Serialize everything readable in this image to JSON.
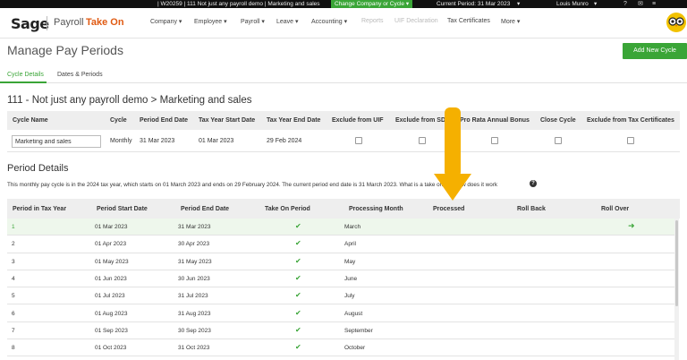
{
  "topbar": {
    "company": "| W20259 | 111 Not just any payroll demo | Marketing and sales",
    "change_button": "Change Company or Cycle ▾",
    "period": "Current Period: 31 Mar 2023",
    "user": "Louis Munro"
  },
  "header": {
    "logo": "Sage",
    "product": "Payroll",
    "module": "Take On",
    "nav": [
      {
        "label": "Company ▾"
      },
      {
        "label": "Employee ▾"
      },
      {
        "label": "Payroll ▾"
      },
      {
        "label": "Leave ▾"
      },
      {
        "label": "Accounting ▾"
      },
      {
        "label": "Reports"
      },
      {
        "label": "UIF Declaration"
      },
      {
        "label": "Tax Certificates"
      },
      {
        "label": "More ▾"
      }
    ]
  },
  "page": {
    "title": "Manage Pay Periods",
    "add_button": "Add New Cycle",
    "tabs": [
      {
        "label": "Cycle Details"
      },
      {
        "label": "Dates & Periods"
      }
    ],
    "section_title": "111 - Not just any payroll demo > Marketing and sales"
  },
  "cycle_table": {
    "headers": [
      "Cycle Name",
      "Cycle",
      "Period End Date",
      "Tax Year Start Date",
      "Tax Year End Date",
      "Exclude from UIF",
      "Exclude from SDL",
      "Pro Rata Annual Bonus",
      "Close Cycle",
      "Exclude from Tax Certificates"
    ],
    "row": {
      "name": "Marketing and sales",
      "cycle": "Monthly",
      "period_end": "31 Mar 2023",
      "tax_start": "01 Mar 2023",
      "tax_end": "29 Feb 2024"
    }
  },
  "period_details": {
    "title": "Period Details",
    "description": "This monthly pay cycle is in the 2024 tax year, which starts on 01 March 2023 and ends on 29 February 2024. The current period end date is 31 March 2023. What is a take on and how does it work",
    "headers": [
      "Period in Tax Year",
      "Period Start Date",
      "Period End Date",
      "Take On Period",
      "Processing Month",
      "Processed",
      "Roll Back",
      "Roll Over"
    ],
    "rows": [
      {
        "num": "1",
        "start": "01 Mar 2023",
        "end": "31 Mar 2023",
        "month": "March"
      },
      {
        "num": "2",
        "start": "01 Apr 2023",
        "end": "30 Apr 2023",
        "month": "April"
      },
      {
        "num": "3",
        "start": "01 May 2023",
        "end": "31 May 2023",
        "month": "May"
      },
      {
        "num": "4",
        "start": "01 Jun 2023",
        "end": "30 Jun 2023",
        "month": "June"
      },
      {
        "num": "5",
        "start": "01 Jul 2023",
        "end": "31 Jul 2023",
        "month": "July"
      },
      {
        "num": "6",
        "start": "01 Aug 2023",
        "end": "31 Aug 2023",
        "month": "August"
      },
      {
        "num": "7",
        "start": "01 Sep 2023",
        "end": "30 Sep 2023",
        "month": "September"
      },
      {
        "num": "8",
        "start": "01 Oct 2023",
        "end": "31 Oct 2023",
        "month": "October"
      }
    ]
  },
  "colors": {
    "accent": "#3aa537",
    "brand_orange": "#e05a12",
    "callout": "#f5b000"
  }
}
